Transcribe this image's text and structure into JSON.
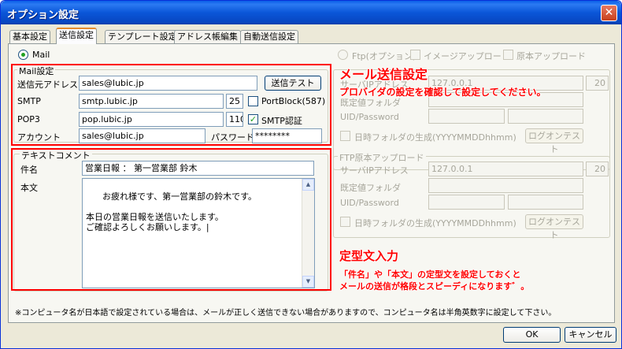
{
  "window": {
    "title": "オプション設定",
    "close_glyph": "✕"
  },
  "tabs": [
    {
      "label": "基本設定"
    },
    {
      "label": "送信設定"
    },
    {
      "label": "テンプレート設定"
    },
    {
      "label": "アドレス帳編集"
    },
    {
      "label": "自動送信設定"
    }
  ],
  "protocol": {
    "mail_label": "Mail",
    "ftp_label": "Ftp(オプション)",
    "image_upload_label": "イメージアップロード",
    "original_upload_label": "原本アップロード"
  },
  "mail_settings": {
    "group_title": "Mail設定",
    "sender_label": "送信元アドレス",
    "sender_value": "sales@lubic.jp",
    "send_test_label": "送信テスト",
    "smtp_label": "SMTP",
    "smtp_value": "smtp.lubic.jp",
    "smtp_port": "25",
    "portblock_label": "PortBlock(587)",
    "pop3_label": "POP3",
    "pop3_value": "pop.lubic.jp",
    "pop3_port": "110",
    "smtp_auth_label": "SMTP認証",
    "account_label": "アカウント",
    "account_value": "sales@lubic.jp",
    "password_label": "パスワード",
    "password_value": "********"
  },
  "text_comment": {
    "group_title": "テキストコメント",
    "subject_label": "件名",
    "subject_value": "営業日報 ： 第一営業部 鈴木",
    "body_label": "本文",
    "body_value": "お疲れ様です、第一営業部の鈴木です。\n\n本日の営業日報を送信いたします。\nご確認よろしくお願いします。|"
  },
  "ftp_image": {
    "server_label": "サーバIPアドレス",
    "server_value": "127.0.0.1",
    "port_value": "20",
    "folder_label": "既定値フォルダ",
    "uid_label": "UID/Password",
    "date_folder_label": "日時フォルダの生成(YYYYMMDDhhmm)",
    "logon_test_label": "ログオンテスト"
  },
  "ftp_original": {
    "group_title": "FTP原本アップロード",
    "server_label": "サーバIPアドレス",
    "server_value": "127.0.0.1",
    "port_value": "20",
    "folder_label": "既定値フォルダ",
    "uid_label": "UID/Password",
    "date_folder_label": "日時フォルダの生成(YYYYMMDDhhmm)",
    "logon_test_label": "ログオンテスト"
  },
  "annotations": {
    "mail_heading": "メール送信設定",
    "mail_note": "プロバイダの設定を確認して設定してください。",
    "template_heading": "定型文入力",
    "template_note_1": "「件名」や「本文」の定型文を設定しておくと",
    "template_note_2": "メールの送信が格段とスピーディになります゛。"
  },
  "footer_note": "※コンピュータ名が日本語で設定されている場合は、メールが正しく送信できない場合がありますので、コンピュータ名は半角英数字に設定して下さい。",
  "buttons": {
    "ok": "OK",
    "cancel": "キャンセル"
  },
  "colors": {
    "annotation_red": "#ff0000",
    "title_blue": "#0a5ee8",
    "check_green": "#21a121"
  }
}
